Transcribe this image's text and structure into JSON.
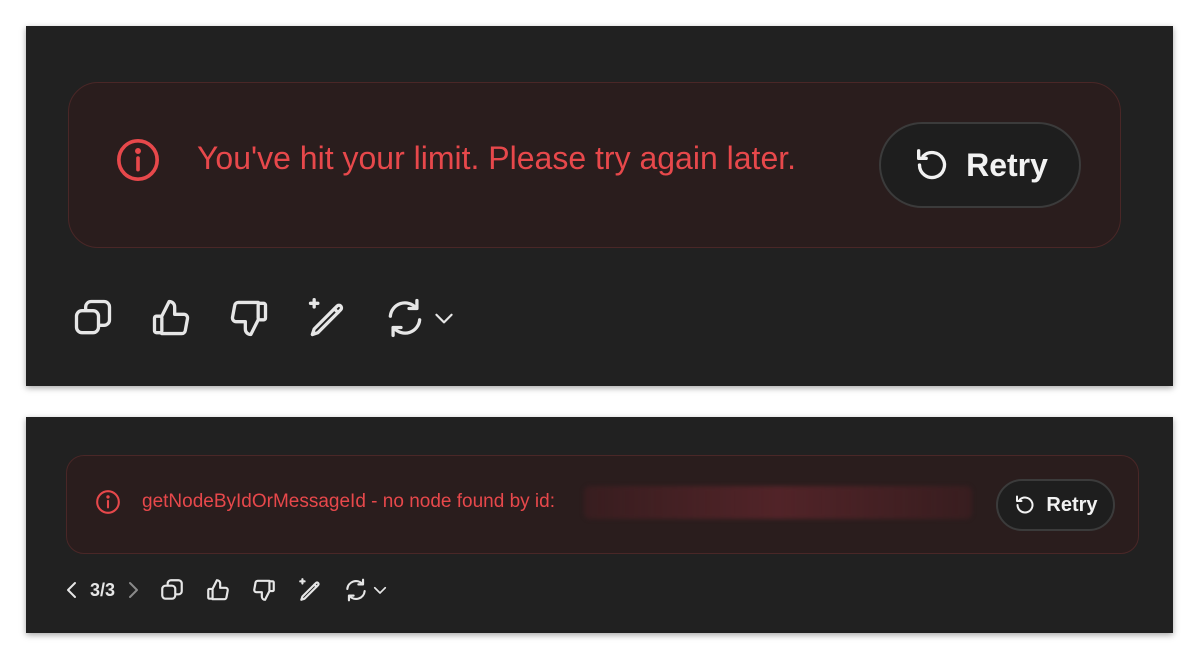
{
  "panel1": {
    "error_message": "You've hit your limit. Please try again later.",
    "retry_label": "Retry",
    "toolbar": [
      "copy-icon",
      "thumbs-up-icon",
      "thumbs-down-icon",
      "edit-sparkle-icon",
      "regenerate-icon",
      "chevron-down-icon"
    ]
  },
  "panel2": {
    "error_message": "getNodeByIdOrMessageId - no node found by id:",
    "retry_label": "Retry",
    "pager": {
      "count": "3/3"
    },
    "toolbar": [
      "copy-icon",
      "thumbs-up-icon",
      "thumbs-down-icon",
      "edit-sparkle-icon",
      "regenerate-icon",
      "chevron-down-icon"
    ]
  },
  "colors": {
    "panel_bg": "#212121",
    "error_bg": "#2a1d1d",
    "error_border": "#4a2727",
    "error_text": "#e7484b",
    "button_bg": "#1e1e1e",
    "button_border": "#3b3b3b",
    "icon": "#e6e6e6"
  }
}
